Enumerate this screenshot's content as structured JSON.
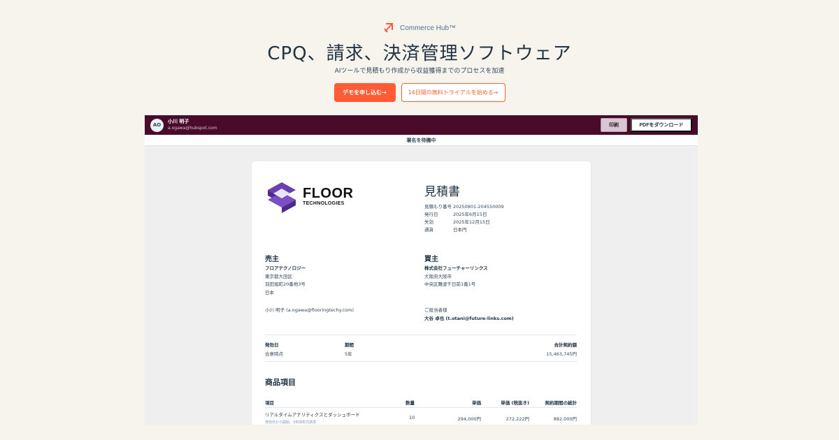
{
  "brand": {
    "name": "Commerce Hub™",
    "icon": "commerce-hub-arrow-icon",
    "accent": "#ff5c35"
  },
  "hero": {
    "title": "CPQ、請求、決済管理ソフトウェア",
    "subtitle": "AIツールで見積もり作成から収益獲得までのプロセスを加速",
    "primary_cta": "デモを申し込む→",
    "secondary_cta": "14日間の無料トライアルを始める→"
  },
  "app": {
    "header_color": "#4a0b2b",
    "user": {
      "initials": "AO",
      "name": "小川 明子",
      "email": "a.ogawa@hubspot.com"
    },
    "actions": {
      "print": "印刷",
      "download_pdf": "PDFをダウンロード"
    },
    "status": "署名を待機中"
  },
  "quote": {
    "logo": {
      "word": "FLOOR",
      "sub": "TECHNOLOGIES",
      "color": "#6a3fb0"
    },
    "title": "見積書",
    "meta": [
      {
        "key": "見積もり番号",
        "value": "20250801-204550009"
      },
      {
        "key": "発行日",
        "value": "2025年6月15日"
      },
      {
        "key": "失効",
        "value": "2025年12月15日"
      },
      {
        "key": "通貨",
        "value": "日本円"
      }
    ],
    "seller": {
      "heading": "売主",
      "company": "フロアテクノロジー",
      "address": [
        "東京都大田区",
        "羽田旭町20番地3号",
        "日本"
      ],
      "contact": "小川 明子 (a.ogawa@flooringtechy.com)"
    },
    "buyer": {
      "heading": "買主",
      "company": "株式会社フューチャーリンクス",
      "address": [
        "大阪府大阪市",
        "中央区難波千日前1番1号"
      ],
      "contact_label": "ご担当者様",
      "contact": "大谷 卓也 (t.otani@future-links.com)"
    },
    "terms": {
      "effective_label": "発効日",
      "effective_value": "合意時点",
      "period_label": "期間",
      "period_value": "5年",
      "total_label": "合計契約額",
      "total_value": "15,463,745円"
    },
    "items": {
      "heading": "商品項目",
      "columns": [
        "項目",
        "数量",
        "単価",
        "単価 (税抜き)",
        "契約期間の総計"
      ],
      "rows": [
        {
          "name": "リアルタイムアナリティクスとダッシュボード",
          "note": "発効日から開始、3年間年次請求",
          "qty": "10",
          "unit_price": "294,000円",
          "unit_price_ex_tax": "272,222円",
          "total": "882,000円"
        }
      ]
    }
  }
}
